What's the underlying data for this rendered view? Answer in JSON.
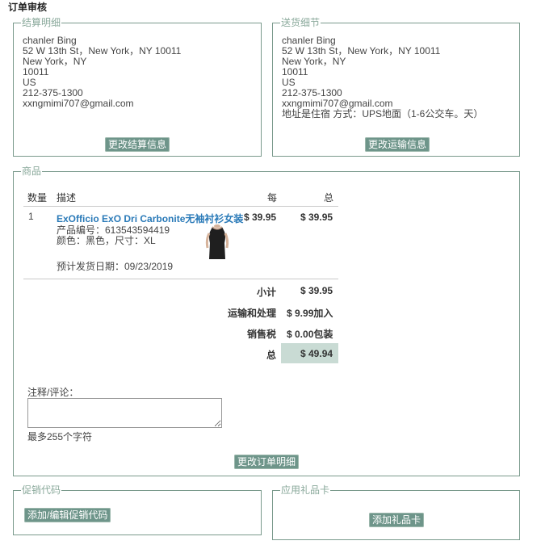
{
  "page_title": "订单审核",
  "billing": {
    "legend": "结算明细",
    "lines": [
      "chanler Bing",
      "52 W 13th St，New York，NY 10011",
      "New York，NY",
      "10011",
      "US",
      "212-375-1300",
      "xxngmimi707@gmail.com"
    ],
    "button": "更改结算信息"
  },
  "shipping": {
    "legend": "送货细节",
    "lines": [
      "chanler Bing",
      "52 W 13th St，New York，NY 10011",
      "New York，NY",
      "10011",
      "US",
      "212-375-1300",
      "xxngmimi707@gmail.com",
      "地址是住宿 方式：UPS地面（1-6公交车。天）"
    ],
    "button": "更改运输信息"
  },
  "products": {
    "legend": "商品",
    "headers": {
      "qty": "数量",
      "desc": "描述",
      "each": "每",
      "total": "总"
    },
    "item": {
      "qty": "1",
      "name": "ExOfficio ExO Dri Carbonite无袖衬衫女装",
      "sku": "产品编号：613543594419",
      "variant": "颜色：黑色，尺寸：XL",
      "ship_date": "预计发货日期：09/23/2019",
      "each": "$ 39.95",
      "total": "$ 39.95"
    },
    "summary": {
      "subtotal_label": "小计",
      "subtotal": "$ 39.95",
      "shipping_label": "运输和处理",
      "shipping": "$ 9.99加入",
      "tax_label": "销售税",
      "tax": "$ 0.00包装",
      "total_label": "总",
      "total": "$ 49.94"
    },
    "comment_label": "注释/评论：",
    "comment_value": "",
    "char_limit": "最多255个字符",
    "button": "更改订单明细"
  },
  "promo": {
    "legend": "促销代码",
    "button": "添加/编辑促销代码"
  },
  "giftcard": {
    "legend": "应用礼品卡",
    "button": "添加礼品卡"
  }
}
